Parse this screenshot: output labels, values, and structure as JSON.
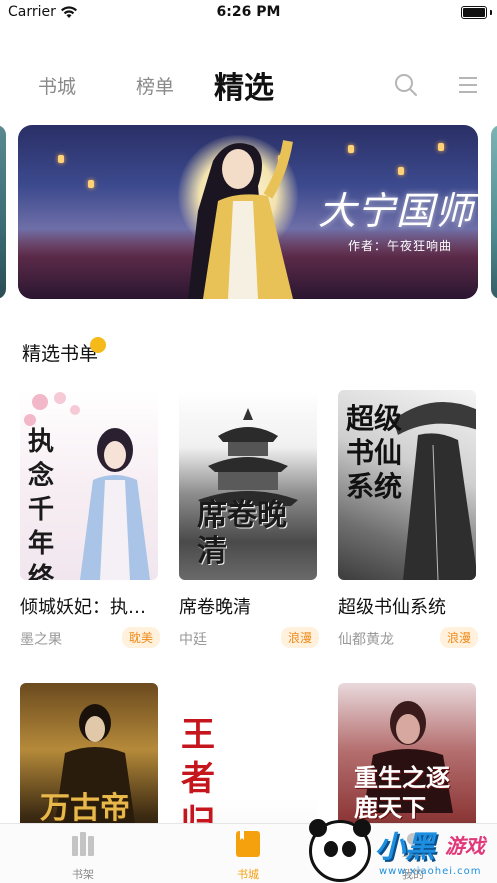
{
  "status_bar": {
    "carrier": "Carrier",
    "time": "6:26 PM",
    "battery_level": 1.0
  },
  "top_nav": {
    "tabs": [
      {
        "label": "书城",
        "active": false
      },
      {
        "label": "榜单",
        "active": false
      },
      {
        "label": "精选",
        "active": true
      }
    ],
    "search_icon": "search-icon",
    "menu_icon": "menu-icon"
  },
  "banner": {
    "title": "大宁国师",
    "author_line": "作者：午夜狂响曲"
  },
  "section": {
    "title": "精选书单"
  },
  "books": [
    {
      "title": "倾城妖妃：执念千年终不悔",
      "display_title": "倾城妖妃：执…",
      "author": "墨之果",
      "tag": "耽美",
      "cover_text": "执念千年终不悔"
    },
    {
      "title": "席卷晚清",
      "display_title": "席卷晚清",
      "author": "中廷",
      "tag": "浪漫",
      "cover_text": "席卷晚清"
    },
    {
      "title": "超级书仙系统",
      "display_title": "超级书仙系统",
      "author": "仙都黄龙",
      "tag": "浪漫",
      "cover_text": "超级书仙系统"
    },
    {
      "cover_text": "万古帝"
    },
    {
      "cover_text": "王者归来"
    },
    {
      "cover_text": "重生之逐鹿天下"
    }
  ],
  "tab_bar": {
    "items": [
      {
        "label": "书架",
        "icon": "bookshelf-icon",
        "active": false
      },
      {
        "label": "书城",
        "icon": "bookstore-icon",
        "active": true
      },
      {
        "label": "我的",
        "icon": "profile-icon",
        "active": false
      }
    ]
  },
  "watermark": {
    "brand": "小黑",
    "brand_suffix": "游戏",
    "url": "www.xiaohei.com"
  },
  "colors": {
    "accent": "#f5a10e",
    "tag_text": "#f08a1c",
    "tag_bg": "#fff1dc",
    "section_dot": "#f6b91a"
  }
}
